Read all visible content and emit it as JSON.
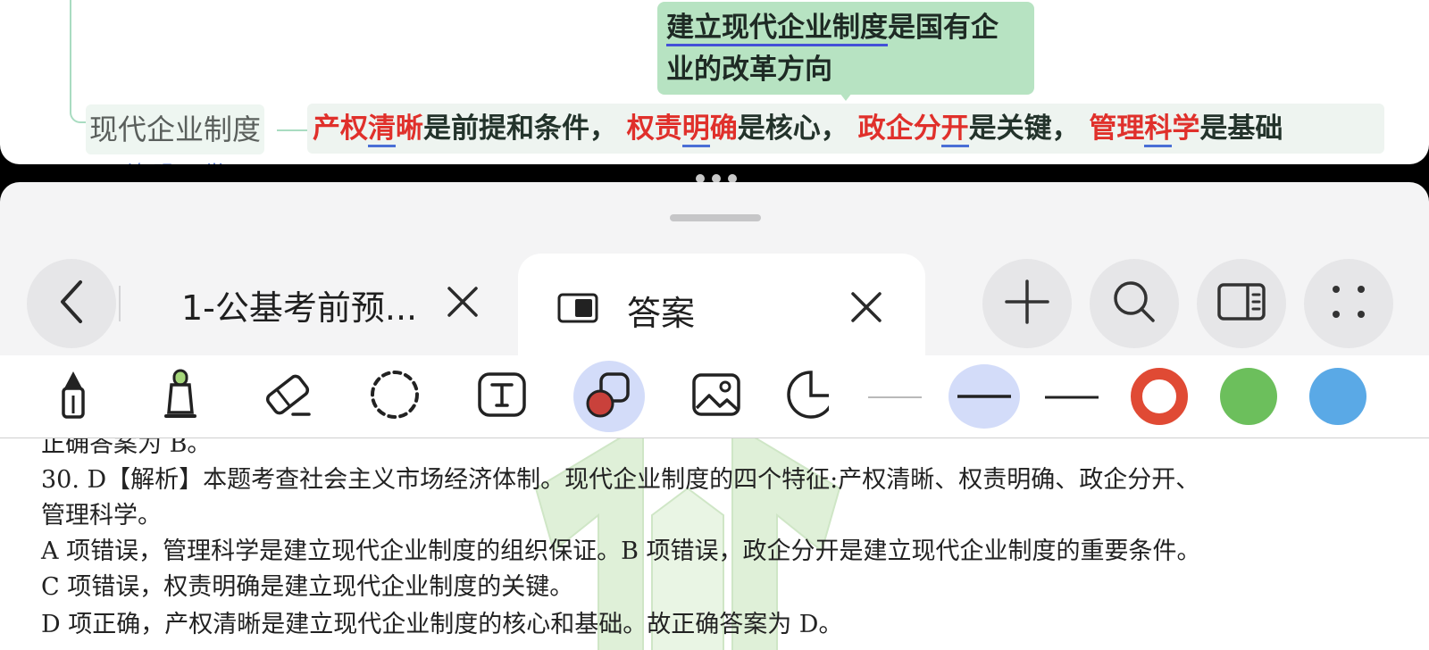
{
  "mindmap": {
    "callout_text_underlined": "建立现代企业制度",
    "callout_text_rest_line1": "是国有企",
    "callout_text_line2": "业的改革方向",
    "node_label": "现代企业制度",
    "features": [
      {
        "pre": "产权",
        "ul": "清",
        "post": "晰",
        "tail": "是前提和条件，"
      },
      {
        "pre": "权责",
        "ul": "明",
        "post": "确",
        "tail": "是核心，"
      },
      {
        "pre": "政企分",
        "ul": "开",
        "post": "",
        "tail": "是关键，"
      },
      {
        "pre": "管理",
        "ul": "科",
        "post": "学",
        "tail": "是基础"
      }
    ],
    "cut_text": "· 清 明 工 学"
  },
  "tabs": [
    {
      "title": "1-公基考前预..."
    },
    {
      "title": "答案"
    }
  ],
  "icons": {
    "back": "chevron-left-icon",
    "close": "close-icon",
    "doc": "document-layout-icon",
    "add": "plus-icon",
    "search": "search-icon",
    "split": "split-view-icon",
    "more": "four-dots-icon",
    "pen": "pen-icon",
    "highlighter": "highlighter-icon",
    "eraser": "eraser-icon",
    "lasso": "lasso-icon",
    "text": "text-box-icon",
    "shape": "shape-icon",
    "image": "image-icon",
    "sticker": "sticker-icon"
  },
  "colors": {
    "accent_selected": "#d3dcf9",
    "stroke_red": "#e04a34",
    "stroke_green": "#6cbf5c",
    "stroke_blue": "#5aa9e6",
    "mindmap_red": "#e0302b",
    "callout_bg": "#b7e3c2"
  },
  "document": {
    "lines": [
      "正确答案为 B。",
      "30. D【解析】本题考查社会主义市场经济体制。现代企业制度的四个特征:产权清晰、权责明确、政企分开、",
      "管理科学。",
      "A 项错误，管理科学是建立现代企业制度的组织保证。B 项错误，政企分开是建立现代企业制度的重要条件。",
      "C 项错误，权责明确是建立现代企业制度的关键。",
      "D 项正确，产权清晰是建立现代企业制度的核心和基础。故正确答案为 D。"
    ]
  }
}
